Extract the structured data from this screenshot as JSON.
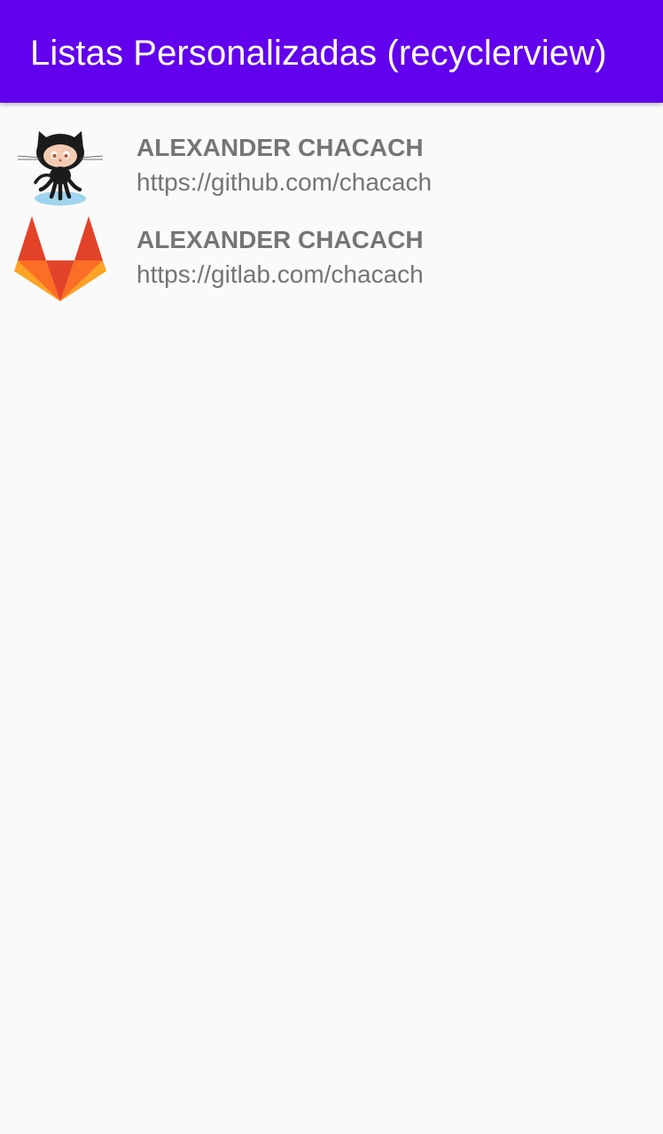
{
  "app_bar": {
    "title": "Listas Personalizadas (recyclerview)",
    "background": "#6200ee"
  },
  "list": {
    "items": [
      {
        "icon": "github-octocat-icon",
        "title": "ALEXANDER CHACACH",
        "url": "https://github.com/chacach"
      },
      {
        "icon": "gitlab-fox-icon",
        "title": "ALEXANDER CHACACH",
        "url": "https://gitlab.com/chacach"
      }
    ]
  }
}
